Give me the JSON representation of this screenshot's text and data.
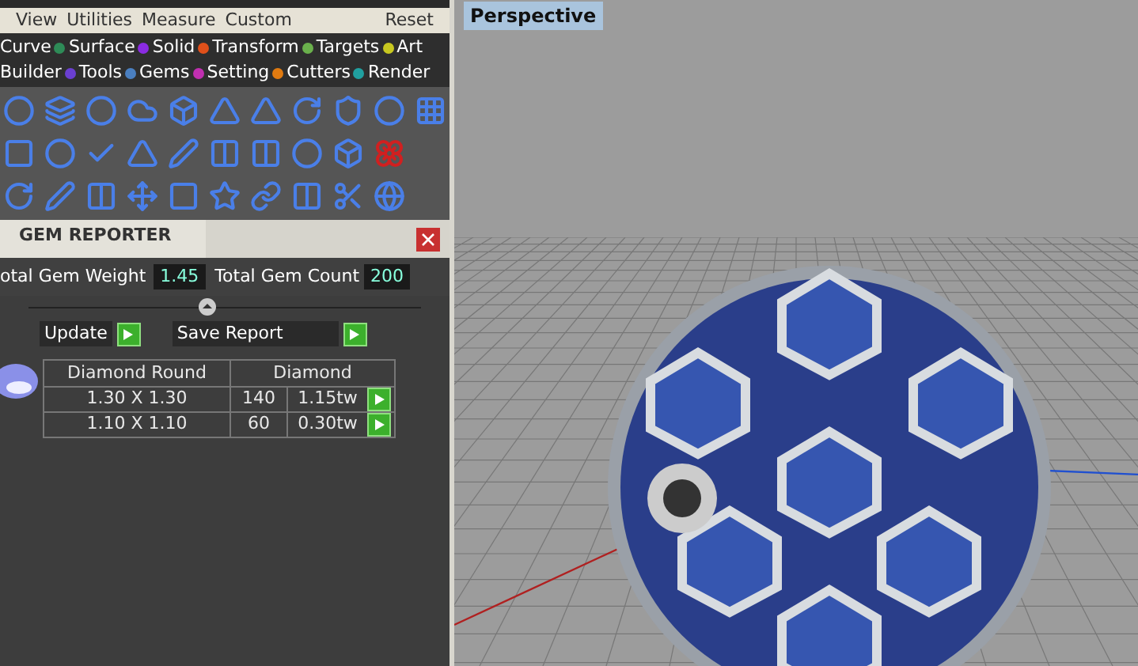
{
  "menu_bar": {
    "items": [
      "View",
      "Utilities",
      "Measure",
      "Custom"
    ],
    "reset": "Reset"
  },
  "categories": [
    [
      {
        "label": "Curve"
      },
      {
        "label": "Surface",
        "color": "#2e8b57"
      },
      {
        "label": "Solid",
        "color": "#8a2be2"
      },
      {
        "label": "Transform",
        "color": "#e0501a"
      },
      {
        "label": "Targets",
        "color": "#6ab04c"
      },
      {
        "label": "Art",
        "color": "#c8c820"
      }
    ],
    [
      {
        "label": "Builder"
      },
      {
        "label": "Tools",
        "color": "#6a3fd0"
      },
      {
        "label": "Gems",
        "color": "#4a7fc0"
      },
      {
        "label": "Setting",
        "color": "#c02fb0"
      },
      {
        "label": "Cutters",
        "color": "#e07a10"
      },
      {
        "label": "Render",
        "color": "#20a0a0"
      }
    ]
  ],
  "gem_reporter": {
    "title": "GEM REPORTER",
    "weight_label": "otal Gem Weight",
    "weight": "1.45",
    "count_label": "Total Gem Count",
    "count": "200",
    "update": "Update",
    "save_report": "Save Report",
    "gem_list": {
      "shape": "Diamond Round",
      "material": "Diamond",
      "sizes": [
        {
          "size": "1.30 X 1.30",
          "count": "140",
          "weight": "1.15tw"
        },
        {
          "size": "1.10 X 1.10",
          "count": "60",
          "weight": "0.30tw"
        }
      ]
    }
  },
  "viewport": {
    "title": "Perspective"
  }
}
